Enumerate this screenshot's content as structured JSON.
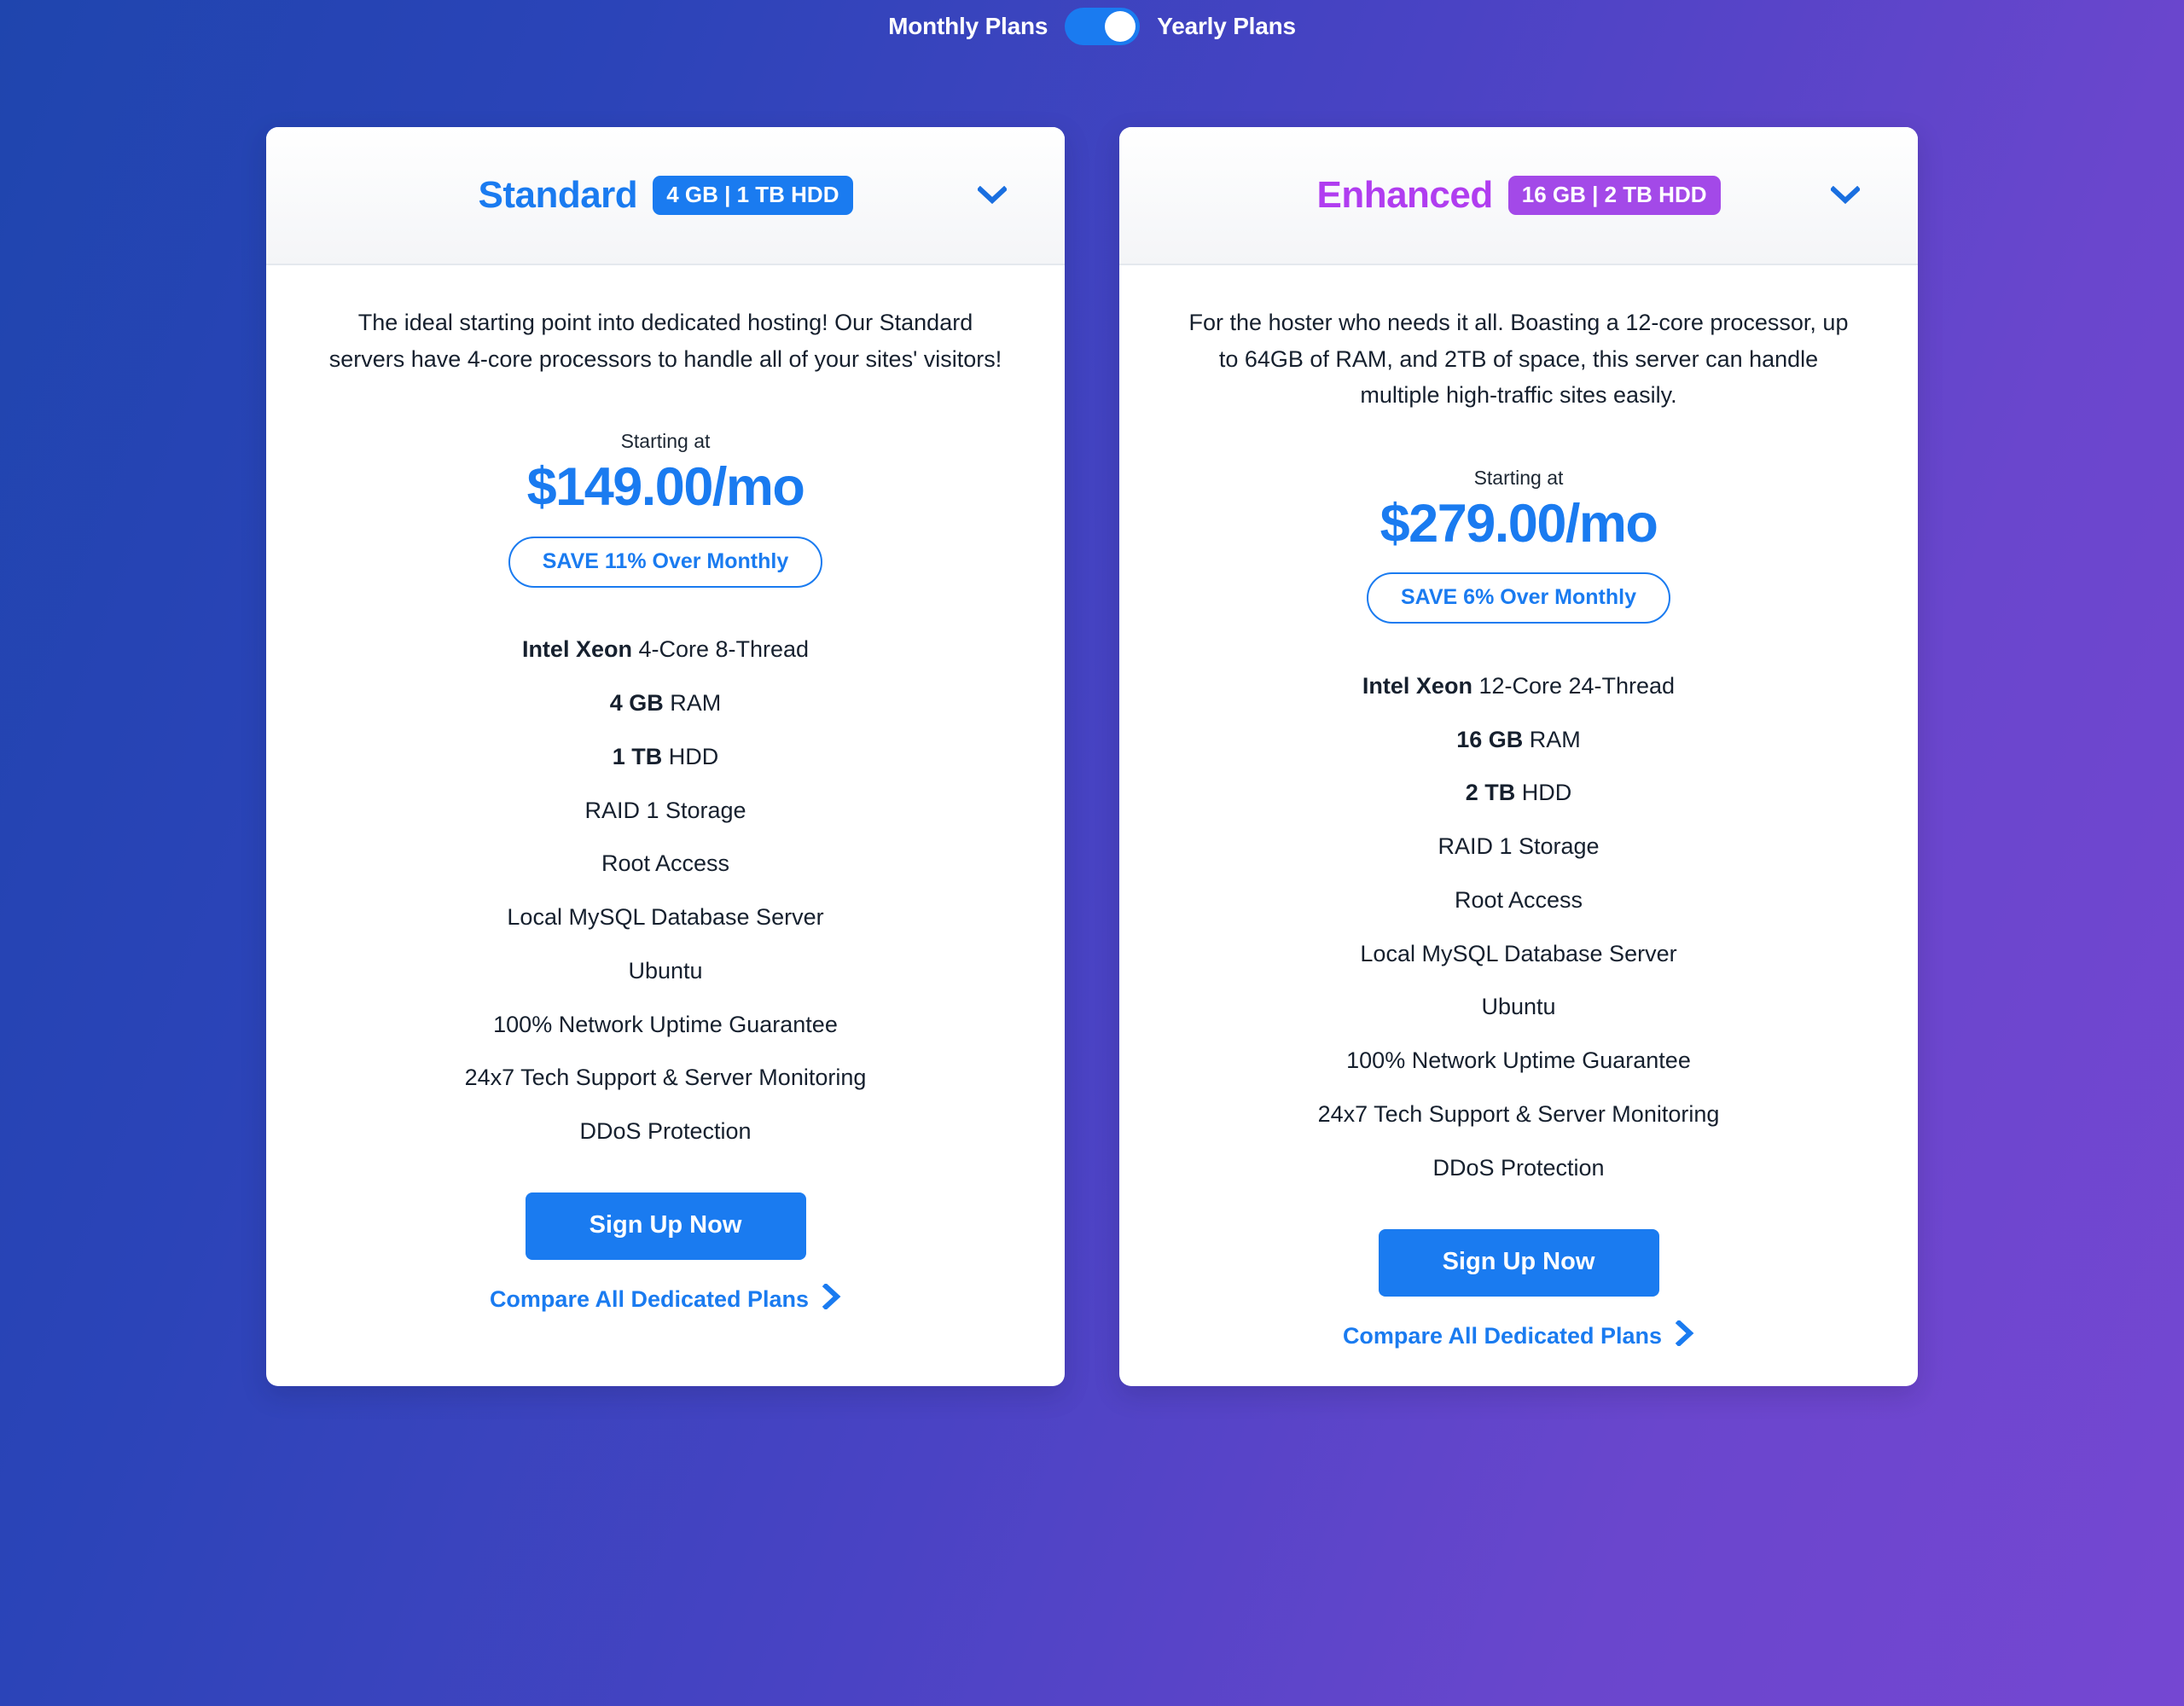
{
  "toggle": {
    "left_label": "Monthly Plans",
    "right_label": "Yearly Plans",
    "state": "yearly",
    "accent_color": "#1a7bf0",
    "knob_color": "#ffffff"
  },
  "background": {
    "gradient_start": "#1f45ae",
    "gradient_end": "#7547d2"
  },
  "plans": [
    {
      "name": "Standard",
      "name_color": "#1a7bf0",
      "badge": "4 GB | 1 TB HDD",
      "badge_color": "#1a7bf0",
      "expand_icon": "chevron-down-icon",
      "description": "The ideal starting point into dedicated hosting! Our Standard servers have 4-core processors to handle all of your sites' visitors!",
      "starting_at_label": "Starting at",
      "price": "$149.00/mo",
      "price_color": "#1a7bf0",
      "save_label": "SAVE 11% Over Monthly",
      "features": [
        {
          "bold": "Intel Xeon",
          "rest": " 4-Core 8-Thread"
        },
        {
          "bold": "4 GB",
          "rest": " RAM"
        },
        {
          "bold": "1 TB",
          "rest": " HDD"
        },
        {
          "bold": "",
          "rest": "RAID 1 Storage"
        },
        {
          "bold": "",
          "rest": "Root Access"
        },
        {
          "bold": "",
          "rest": "Local MySQL Database Server"
        },
        {
          "bold": "",
          "rest": "Ubuntu"
        },
        {
          "bold": "",
          "rest": "100% Network Uptime Guarantee"
        },
        {
          "bold": "",
          "rest": "24x7 Tech Support & Server Monitoring"
        },
        {
          "bold": "",
          "rest": "DDoS Protection"
        }
      ],
      "signup_label": "Sign Up Now",
      "compare_label": "Compare All Dedicated Plans",
      "compare_icon": "chevron-right-icon"
    },
    {
      "name": "Enhanced",
      "name_color": "#b03df0",
      "badge": "16 GB | 2 TB HDD",
      "badge_color": "#a349e8",
      "expand_icon": "chevron-down-icon",
      "description": "For the hoster who needs it all. Boasting a 12-core processor, up to 64GB of RAM, and 2TB of space, this server can handle multiple high-traffic sites easily.",
      "starting_at_label": "Starting at",
      "price": "$279.00/mo",
      "price_color": "#1a7bf0",
      "save_label": "SAVE 6% Over Monthly",
      "features": [
        {
          "bold": "Intel Xeon",
          "rest": " 12-Core 24-Thread"
        },
        {
          "bold": "16 GB",
          "rest": " RAM"
        },
        {
          "bold": "2 TB",
          "rest": " HDD"
        },
        {
          "bold": "",
          "rest": "RAID 1 Storage"
        },
        {
          "bold": "",
          "rest": "Root Access"
        },
        {
          "bold": "",
          "rest": "Local MySQL Database Server"
        },
        {
          "bold": "",
          "rest": "Ubuntu"
        },
        {
          "bold": "",
          "rest": "100% Network Uptime Guarantee"
        },
        {
          "bold": "",
          "rest": "24x7 Tech Support & Server Monitoring"
        },
        {
          "bold": "",
          "rest": "DDoS Protection"
        }
      ],
      "signup_label": "Sign Up Now",
      "compare_label": "Compare All Dedicated Plans",
      "compare_icon": "chevron-right-icon"
    }
  ]
}
